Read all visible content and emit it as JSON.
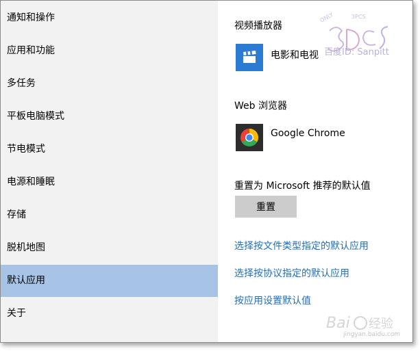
{
  "sidebar": {
    "items": [
      {
        "label": "通知和操作"
      },
      {
        "label": "应用和功能"
      },
      {
        "label": "多任务"
      },
      {
        "label": "平板电脑模式"
      },
      {
        "label": "节电模式"
      },
      {
        "label": "电源和睡眠"
      },
      {
        "label": "存储"
      },
      {
        "label": "脱机地图"
      },
      {
        "label": "默认应用",
        "selected": true
      },
      {
        "label": "关于"
      }
    ]
  },
  "content": {
    "video_player": {
      "title": "视频播放器",
      "app": "电影和电视",
      "icon": "clapperboard-icon"
    },
    "web_browser": {
      "title": "Web 浏览器",
      "app": "Google Chrome",
      "icon": "chrome-icon"
    },
    "reset": {
      "description": "重置为 Microsoft 推荐的默认值",
      "button_label": "重置"
    },
    "links": [
      "选择按文件类型指定的默认应用",
      "选择按协议指定的默认应用",
      "按应用设置默认值"
    ]
  },
  "watermark": {
    "top_text": "百度ID: Sanpitt",
    "bottom_url": "jingyan.baidu.com"
  },
  "colors": {
    "sidebar_bg": "#f2f2f2",
    "selected_bg": "#a7c4e6",
    "link": "#1f6fbf",
    "video_icon_bg": "#2b7bd3",
    "button_bg": "#cccccc"
  }
}
